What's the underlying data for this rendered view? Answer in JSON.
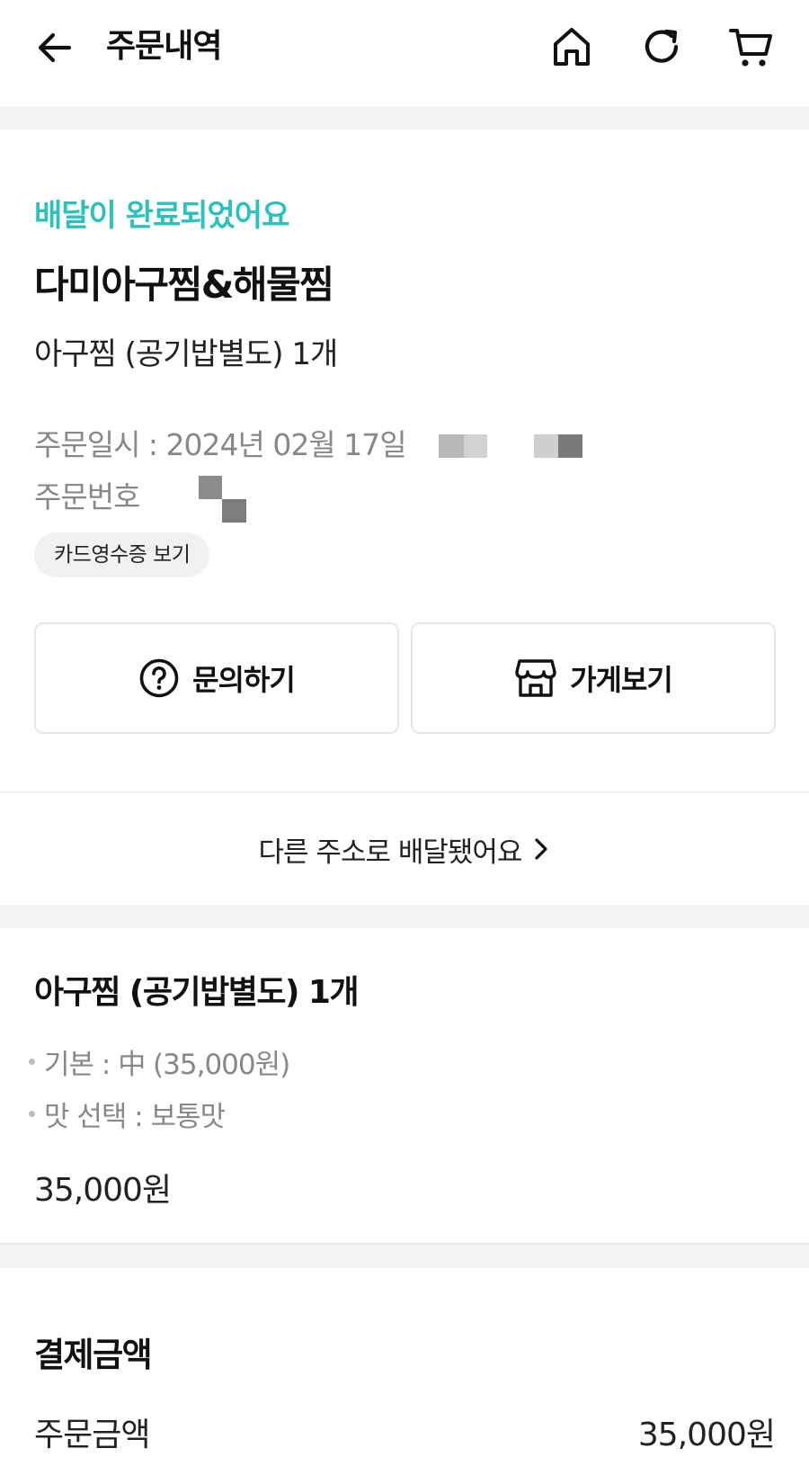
{
  "header": {
    "title": "주문내역",
    "icons": [
      "back-arrow-icon",
      "home-icon",
      "refresh-icon",
      "cart-icon"
    ]
  },
  "order": {
    "status": "배달이 완료되었어요",
    "store_name": "다미아구찜&해물찜",
    "summary": "아구찜 (공기밥별도) 1개",
    "order_datetime_label": "주문일시 : 2024년 02월 17일",
    "order_number_label": "주문번호",
    "receipt_button": "카드영수증 보기"
  },
  "actions": {
    "inquiry_label": "문의하기",
    "store_label": "가게보기"
  },
  "address_notice": "다른 주소로 배달됐어요",
  "item": {
    "title": "아구찜 (공기밥별도) 1개",
    "options": [
      "기본 : 中 (35,000원)",
      "맛 선택 : 보통맛"
    ],
    "price": "35,000원"
  },
  "payment": {
    "title": "결제금액",
    "order_amount_label": "주문금액",
    "order_amount_value": "35,000원"
  },
  "colors": {
    "status_accent": "#2bc1bc",
    "section_gap": "#f2f3f5"
  }
}
